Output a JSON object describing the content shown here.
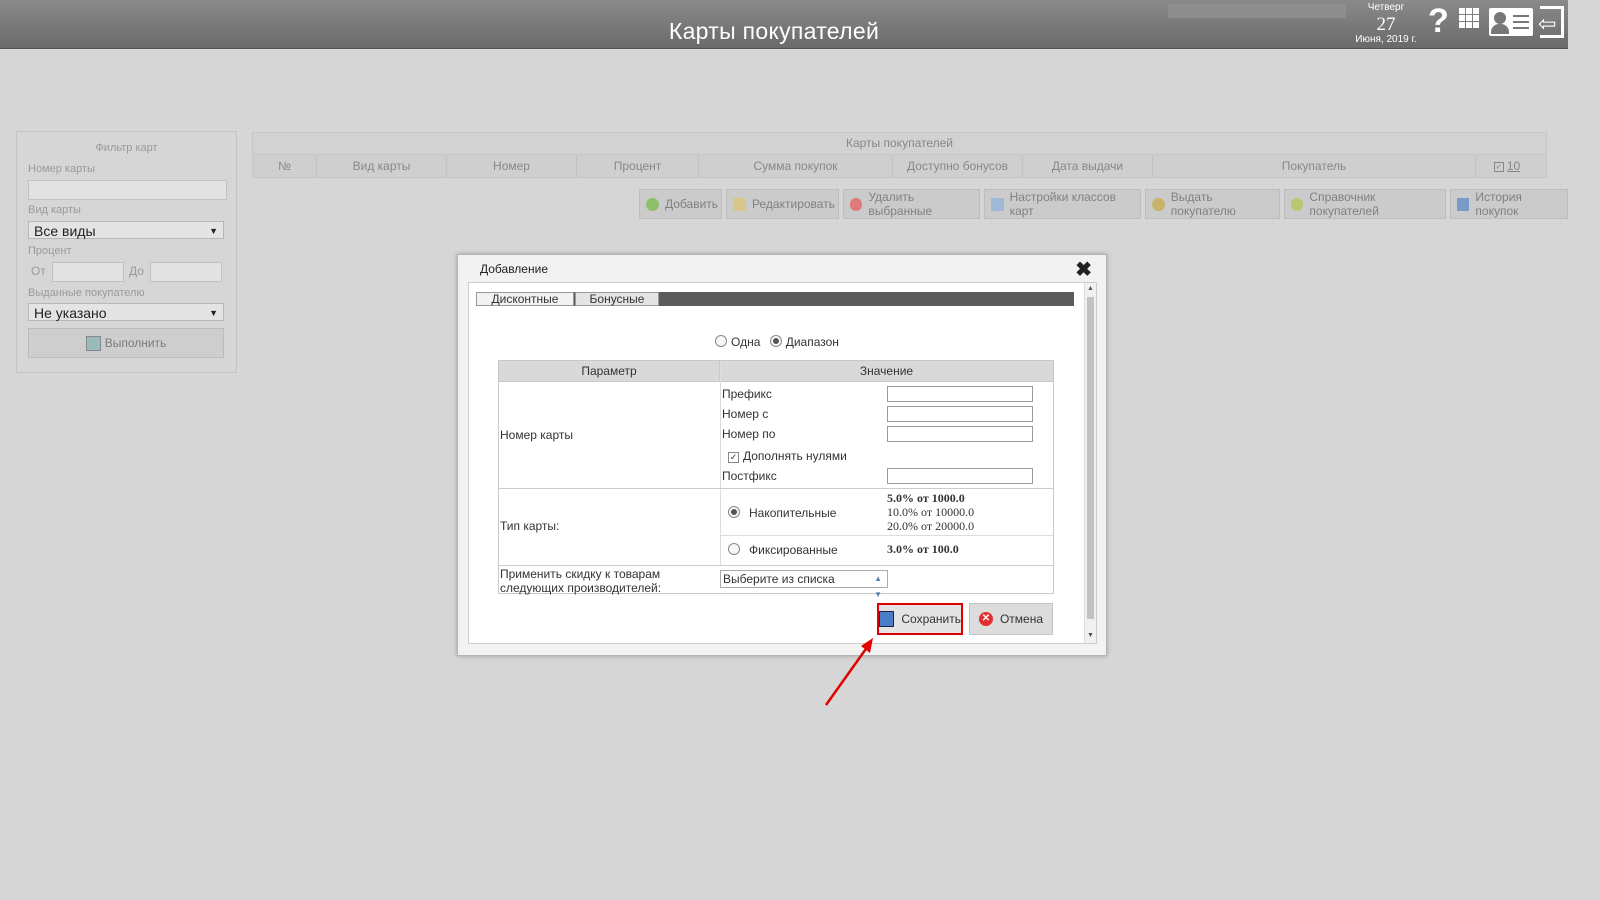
{
  "header": {
    "title": "Карты покупателей",
    "day_of_week": "Четверг",
    "day": "27",
    "month_year": "Июня, 2019 г.",
    "help_icon": "?"
  },
  "filter": {
    "title": "Фильтр карт",
    "card_number_label": "Номер карты",
    "card_type_label": "Вид карты",
    "card_type_value": "Все виды",
    "percent_label": "Процент",
    "from_label": "От",
    "to_label": "До",
    "issued_label": "Выданные покупателю",
    "issued_value": "Не указано",
    "run_label": "Выполнить"
  },
  "table": {
    "caption": "Карты покупателей",
    "columns": [
      "№",
      "Вид карты",
      "Номер",
      "Процент",
      "Сумма покупок",
      "Доступно бонусов",
      "Дата выдачи",
      "Покупатель"
    ],
    "page_size": "10"
  },
  "toolbar": [
    "Добавить",
    "Редактировать",
    "Удалить выбранные",
    "Настройки классов карт",
    "Выдать покупателю",
    "Справочник покупателей",
    "История покупок"
  ],
  "dialog": {
    "title": "Добавление",
    "tabs": [
      "Дисконтные",
      "Бонусные"
    ],
    "mode_one": "Одна",
    "mode_range": "Диапазон",
    "col_param": "Параметр",
    "col_value": "Значение",
    "card_number": "Номер карты",
    "prefix": "Префикс",
    "number_from": "Номер с",
    "number_to": "Номер по",
    "pad_zeros": "Дополнять нулями",
    "postfix": "Постфикс",
    "card_type": "Тип карты:",
    "cumulative": "Накопительные",
    "cumulative_levels": [
      "5.0% от 1000.0",
      "10.0% от 10000.0",
      "20.0% от 20000.0"
    ],
    "fixed": "Фиксированные",
    "fixed_level": "3.0% от 100.0",
    "apply_line1": "Применить скидку к товарам",
    "apply_line2": "следующих производителей:",
    "select_placeholder": "Выберите из списка",
    "save": "Сохранить",
    "cancel": "Отмена"
  }
}
